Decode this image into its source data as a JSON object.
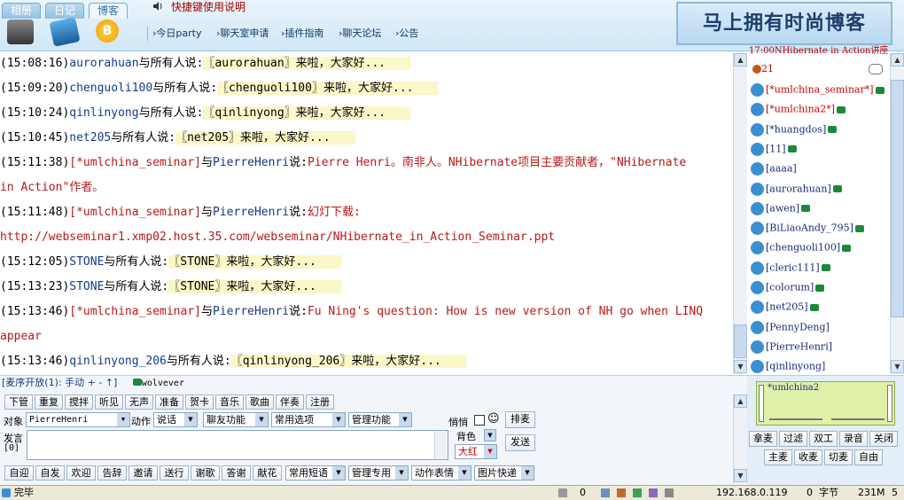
{
  "tabs": [
    {
      "label": "相册"
    },
    {
      "label": "日记"
    },
    {
      "label": "博客"
    }
  ],
  "shortcut_label": "快捷键使用说明",
  "nav": [
    {
      "label": "今日party"
    },
    {
      "label": "聊天室申请"
    },
    {
      "label": "插件指南"
    },
    {
      "label": "聊天论坛"
    },
    {
      "label": "公告"
    }
  ],
  "banner": "马上拥有时尚博客",
  "chat": [
    {
      "time": "(15:08:16)",
      "sender": "aurorahuan",
      "mid": "与所有人说:",
      "body": "〖aurorahuan〗来啦，大家好...",
      "kind": "welcome"
    },
    {
      "time": "(15:09:20)",
      "sender": "chenguoli100",
      "mid": "与所有人说:",
      "body": "〖chenguoli100〗来啦，大家好...",
      "kind": "welcome"
    },
    {
      "time": "(15:10:24)",
      "sender": "qinlinyong",
      "mid": "与所有人说:",
      "body": "〖qinlinyong〗来啦，大家好...",
      "kind": "welcome"
    },
    {
      "time": "(15:10:45)",
      "sender": "net205",
      "mid": "与所有人说:",
      "body": "〖net205〗来啦，大家好...",
      "kind": "welcome"
    },
    {
      "time": "(15:11:38)",
      "sender": "[*umlchina_seminar]",
      "mid": "与",
      "target": "PierreHenri",
      "mid2": "说:",
      "body": "Pierre Henri。南非人。NHibernate项目主要贡献者，\"NHibernate",
      "kind": "msg"
    },
    {
      "text": "in Action\"作者。",
      "kind": "cont"
    },
    {
      "time": "(15:11:48)",
      "sender": "[*umlchina_seminar]",
      "mid": "与",
      "target": "PierreHenri",
      "mid2": "说:",
      "body": "幻灯下载:",
      "kind": "msg"
    },
    {
      "text": "http://webseminar1.xmp02.host.35.com/webseminar/NHibernate_in_Action_Seminar.ppt",
      "kind": "cont"
    },
    {
      "time": "(15:12:05)",
      "sender": "STONE",
      "mid": "与所有人说:",
      "body": "〖STONE〗来啦，大家好...",
      "kind": "welcome"
    },
    {
      "time": "(15:13:23)",
      "sender": "STONE",
      "mid": "与所有人说:",
      "body": "〖STONE〗来啦，大家好...",
      "kind": "welcome"
    },
    {
      "time": "(15:13:46)",
      "sender": "[*umlchina_seminar]",
      "mid": "与",
      "target": "PierreHenri",
      "mid2": "说:",
      "body": "Fu Ning's question: How is new version of NH go when LINQ",
      "kind": "msg"
    },
    {
      "text": "appear",
      "kind": "cont"
    },
    {
      "time": "(15:13:46)",
      "sender": "qinlinyong_206",
      "mid": "与所有人说:",
      "body": "〖qinlinyong_206〗来啦，大家好...",
      "kind": "welcome"
    }
  ],
  "room_title": "17:00NHibernate in Action讲座",
  "room_count": "21",
  "users": [
    {
      "name": "[*umlchina_seminar*]",
      "phone": true,
      "red": true
    },
    {
      "name": "[*umlchina2*]",
      "phone": true,
      "red": true
    },
    {
      "name": "[*huangdos]",
      "phone": true,
      "red": false
    },
    {
      "name": "[11]",
      "phone": true,
      "red": false
    },
    {
      "name": "[aaaa]",
      "phone": false,
      "red": false
    },
    {
      "name": "[aurorahuan]",
      "phone": true,
      "red": false
    },
    {
      "name": "[awen]",
      "phone": true,
      "red": false
    },
    {
      "name": "[BiLiaoAndy_795]",
      "phone": true,
      "red": false
    },
    {
      "name": "[chenguoli100]",
      "phone": true,
      "red": false
    },
    {
      "name": "[cleric111]",
      "phone": true,
      "red": false
    },
    {
      "name": "[colorum]",
      "phone": true,
      "red": false
    },
    {
      "name": "[net205]",
      "phone": true,
      "red": false
    },
    {
      "name": "[PennyDeng]",
      "phone": false,
      "red": false
    },
    {
      "name": "[PierreHenri]",
      "phone": false,
      "red": false
    },
    {
      "name": "[qinlinyong]",
      "phone": false,
      "red": false
    }
  ],
  "mic": {
    "label": "[麦序开放(1):",
    "mode": "手动",
    "plus": "+",
    "minus": "-",
    "up": "↑",
    "close": "]",
    "speaker": "wolvever"
  },
  "row1": [
    "下管",
    "重复",
    "搅拌",
    "听见",
    "无声",
    "准备",
    "贺卡",
    "音乐",
    "歌曲",
    "伴奏",
    "注册"
  ],
  "target_label": "对象",
  "target_value": "PierreHenri",
  "action_label": "动作",
  "action_value": "说话",
  "friend_fn": "聊友功能",
  "common_opts": "常用选项",
  "admin_fn": "管理功能",
  "quiet_label": "悄悄",
  "smile": "☺",
  "order_btn": "排麦",
  "speak_label": "发言",
  "speak_count": "[0]",
  "bg_label": "背色",
  "color_value": "大红",
  "send_btn": "发送",
  "row3": [
    "自迎",
    "自发",
    "欢迎",
    "告辞",
    "邀请",
    "送行",
    "谢歌",
    "答谢",
    "献花"
  ],
  "row3_selects": [
    "常用短语",
    "管理专用",
    "动作表情",
    "图片快递"
  ],
  "mic_user": "*umlchina2",
  "right_btns1": [
    "拿麦",
    "过滤",
    "双工",
    "录音",
    "关闭"
  ],
  "right_btns2": [
    "主麦",
    "收麦",
    "切麦",
    "自由"
  ],
  "status": {
    "done": "完毕",
    "zero1": "0",
    "ip": "192.168.0.119",
    "zero2": "0",
    "bytes": "字节",
    "mem": "231M",
    "num": "5"
  },
  "accent": "#b81818"
}
